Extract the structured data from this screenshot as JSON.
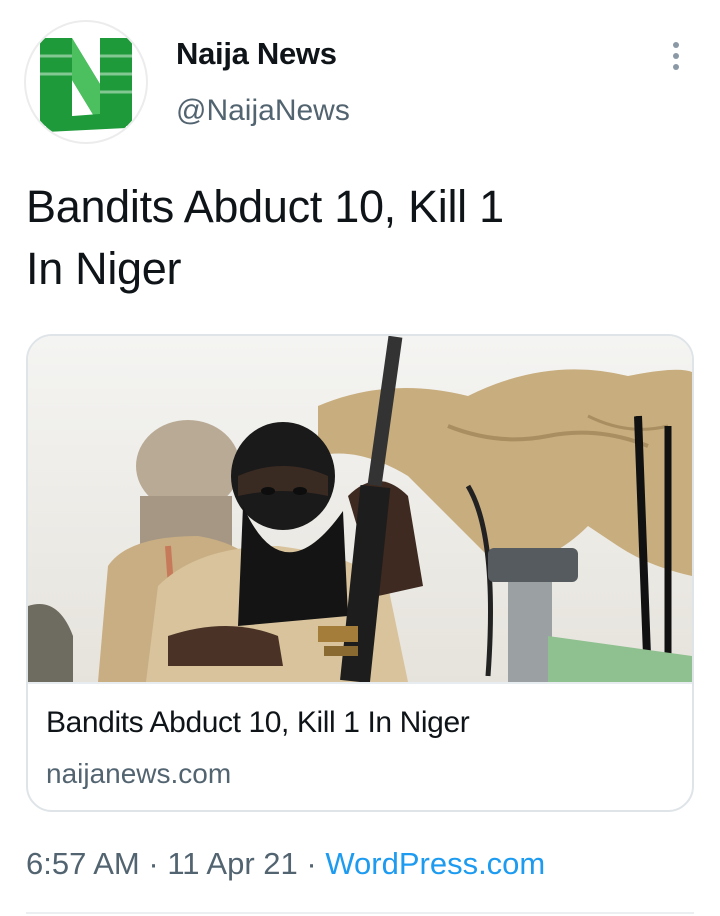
{
  "author": {
    "name": "Naija News",
    "handle": "@NaijaNews",
    "avatar_logo_text": "NaijaNews",
    "avatar_colors": {
      "green": "#1e9a3a",
      "white": "#ffffff"
    }
  },
  "tweet": {
    "text_line1": "Bandits Abduct 10, Kill 1",
    "text_line2": "In Niger"
  },
  "card": {
    "image_subject": "masked-gunmen-photo",
    "title": "Bandits Abduct 10, Kill 1 In Niger",
    "domain": "naijanews.com"
  },
  "meta": {
    "time": "6:57 AM",
    "separator": "·",
    "date": "11 Apr 21",
    "source": "WordPress.com"
  },
  "colors": {
    "text_primary": "#0f1419",
    "text_secondary": "#536471",
    "link": "#1d9bf0",
    "border": "#dfe4e8"
  },
  "icons": {
    "more": "more-vertical-icon"
  }
}
